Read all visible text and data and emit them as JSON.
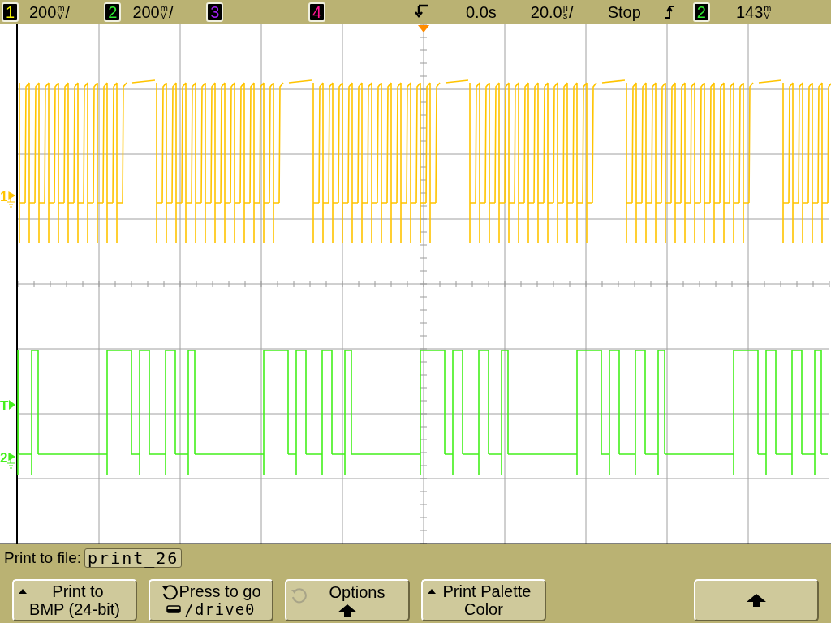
{
  "status_bar": {
    "channels": [
      {
        "number": "1",
        "scale": "200",
        "unit_prefix": "m",
        "unit": "V",
        "suffix": "/"
      },
      {
        "number": "2",
        "scale": "200",
        "unit_prefix": "m",
        "unit": "V",
        "suffix": "/"
      },
      {
        "number": "3"
      },
      {
        "number": "4"
      }
    ],
    "timebase": {
      "delay": "0.0s",
      "scale": "20.0",
      "unit_prefix": "µ",
      "unit": "s",
      "suffix": "/"
    },
    "run_state": "Stop",
    "trigger": {
      "source": "2",
      "level": "143",
      "unit_prefix": "m",
      "unit": "V"
    }
  },
  "traces": [
    {
      "color": "#ffc400",
      "kind": "burst"
    },
    {
      "color": "#44f01c",
      "kind": "frame"
    }
  ],
  "markers": [
    {
      "label": "1",
      "color": "#ffc400",
      "kind": "ground"
    },
    {
      "label": "T",
      "color": "#44f01c",
      "kind": "trigger"
    },
    {
      "label": "2",
      "color": "#44f01c",
      "kind": "ground"
    }
  ],
  "softkeys": {
    "prompt": "Print to file:",
    "filename": "print_26",
    "keys": [
      {
        "kind": "select",
        "line1": "Print to",
        "line2": "BMP (24-bit)"
      },
      {
        "kind": "go",
        "line1": "Press to go",
        "line2": "/drive0"
      },
      {
        "kind": "submenu",
        "line1": "Options"
      },
      {
        "kind": "select",
        "line1": "Print Palette",
        "line2": "Color"
      },
      {
        "kind": "up"
      }
    ]
  }
}
